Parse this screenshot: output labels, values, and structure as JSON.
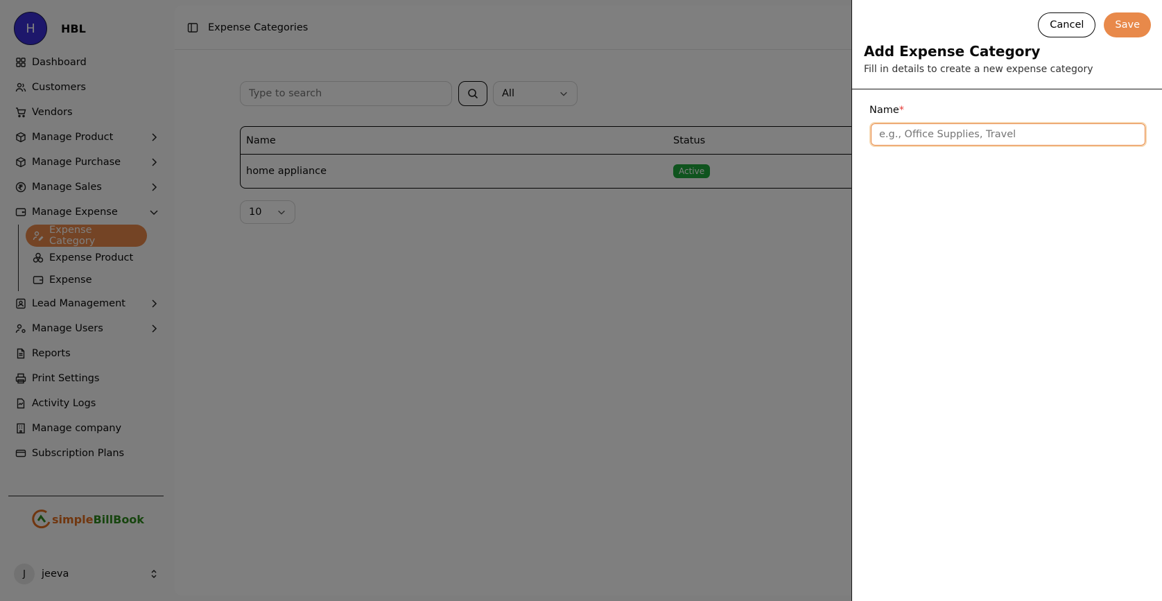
{
  "brand": {
    "initial": "H",
    "name": "HBL"
  },
  "sidebar": {
    "items": [
      {
        "label": "Dashboard",
        "icon": "dashboard-icon"
      },
      {
        "label": "Customers",
        "icon": "users-icon"
      },
      {
        "label": "Vendors",
        "icon": "cart-icon"
      },
      {
        "label": "Manage Product",
        "icon": "package-icon"
      },
      {
        "label": "Manage Purchase",
        "icon": "package-icon"
      },
      {
        "label": "Manage Sales",
        "icon": "rupee-icon"
      },
      {
        "label": "Manage Expense",
        "icon": "wallet-icon"
      },
      {
        "label": "Lead Management",
        "icon": "contact-icon"
      },
      {
        "label": "Manage Users",
        "icon": "user-cog-icon"
      },
      {
        "label": "Reports",
        "icon": "file-icon"
      },
      {
        "label": "Print Settings",
        "icon": "printer-icon"
      },
      {
        "label": "Activity Logs",
        "icon": "activity-icon"
      },
      {
        "label": "Manage company",
        "icon": "building-icon"
      },
      {
        "label": "Subscription Plans",
        "icon": "card-icon"
      }
    ],
    "expense_sub": [
      {
        "label": "Expense Category",
        "icon": "user-pen-icon"
      },
      {
        "label": "Expense Product",
        "icon": "boxes-icon"
      },
      {
        "label": "Expense",
        "icon": "wallet-icon"
      }
    ]
  },
  "logo": {
    "part1": "simple",
    "part2": "BillBook"
  },
  "user": {
    "initial": "J",
    "name": "jeeva"
  },
  "header": {
    "title": "Expense Categories"
  },
  "filters": {
    "search_placeholder": "Type to search",
    "status_value": "All"
  },
  "table": {
    "columns": [
      "Name",
      "Status"
    ],
    "rows": [
      {
        "name": "home appliance",
        "status": "Active"
      }
    ]
  },
  "pagination": {
    "page_size": "10"
  },
  "drawer": {
    "cancel_label": "Cancel",
    "save_label": "Save",
    "title": "Add Expense Category",
    "subtitle": "Fill in details to create a new expense category",
    "name_label": "Name",
    "required_mark": "*",
    "name_placeholder": "e.g., Office Supplies, Travel"
  },
  "colors": {
    "accent": "#e8894a",
    "brand": "#3b2fd6",
    "success": "#1fa83d"
  }
}
